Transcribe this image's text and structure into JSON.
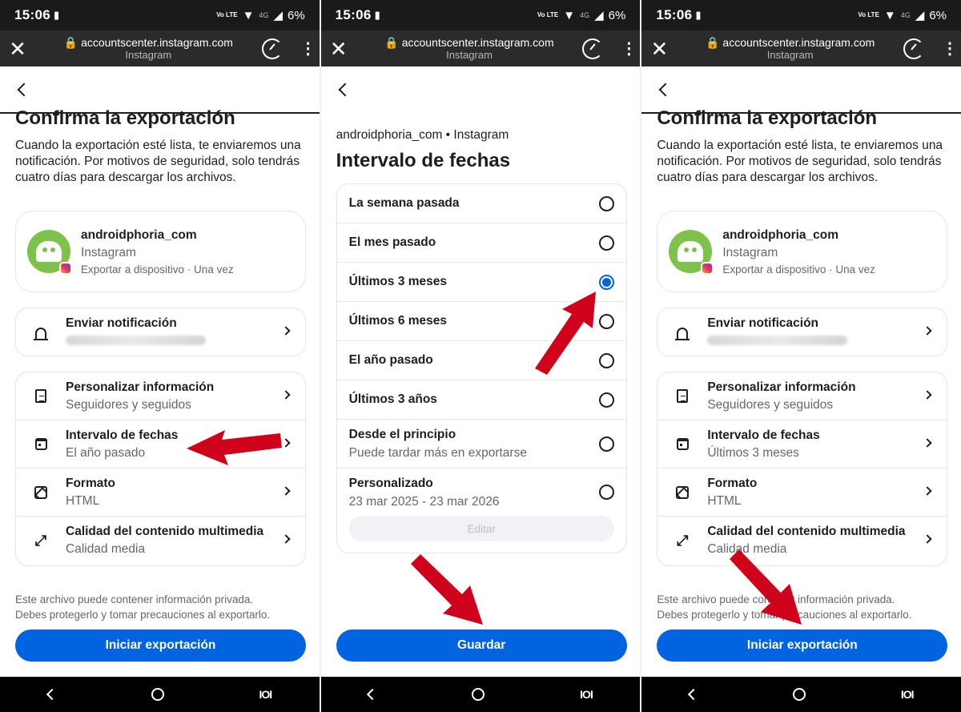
{
  "status": {
    "time": "15:06",
    "volte": "Vo LTE",
    "network": "4G",
    "battery": "6%"
  },
  "browser": {
    "url": "accountscenter.instagram.com",
    "site": "Instagram",
    "close": "✕",
    "menu": "⋮"
  },
  "confirm": {
    "title": "Confirma la exportación",
    "description": "Cuando la exportación esté lista, te enviaremos una notificación. Por motivos de seguridad, solo tendrás cuatro días para descargar los archivos.",
    "account": {
      "name": "androidphoria_com",
      "platform": "Instagram",
      "meta": "Exportar a dispositivo · Una vez"
    },
    "notify": {
      "label": "Enviar notificación"
    },
    "settings_left": [
      {
        "label": "Personalizar información",
        "value": "Seguidores y seguidos",
        "icon": "document-icon"
      },
      {
        "label": "Intervalo de fechas",
        "value": "El año pasado",
        "icon": "calendar-icon"
      },
      {
        "label": "Formato",
        "value": "HTML",
        "icon": "image-icon"
      },
      {
        "label": "Calidad del contenido multimedia",
        "value": "Calidad media",
        "icon": "expand-icon"
      }
    ],
    "settings_right": [
      {
        "label": "Personalizar información",
        "value": "Seguidores y seguidos",
        "icon": "document-icon"
      },
      {
        "label": "Intervalo de fechas",
        "value": "Últimos 3 meses",
        "icon": "calendar-icon"
      },
      {
        "label": "Formato",
        "value": "HTML",
        "icon": "image-icon"
      },
      {
        "label": "Calidad del contenido multimedia",
        "value": "Calidad media",
        "icon": "expand-icon"
      }
    ],
    "footer_line1": "Este archivo puede contener información privada.",
    "footer_line2": "Debes protegerlo y tomar precauciones al exportarlo.",
    "button": "Iniciar exportación"
  },
  "range": {
    "subtitle": "androidphoria_com • Instagram",
    "title": "Intervalo de fechas",
    "options": [
      {
        "label": "La semana pasada",
        "selected": false
      },
      {
        "label": "El mes pasado",
        "selected": false
      },
      {
        "label": "Últimos 3 meses",
        "selected": true
      },
      {
        "label": "Últimos 6 meses",
        "selected": false
      },
      {
        "label": "El año pasado",
        "selected": false
      },
      {
        "label": "Últimos 3 años",
        "selected": false
      },
      {
        "label": "Desde el principio",
        "detail": "Puede tardar más en exportarse",
        "selected": false
      },
      {
        "label": "Personalizado",
        "detail": "23 mar 2025 - 23 mar 2026",
        "selected": false
      }
    ],
    "edit": "Editar",
    "button": "Guardar"
  },
  "nav": {
    "recents": "IOI"
  },
  "colors": {
    "accent": "#0064e0",
    "annotation_arrow": "#d0021b"
  }
}
